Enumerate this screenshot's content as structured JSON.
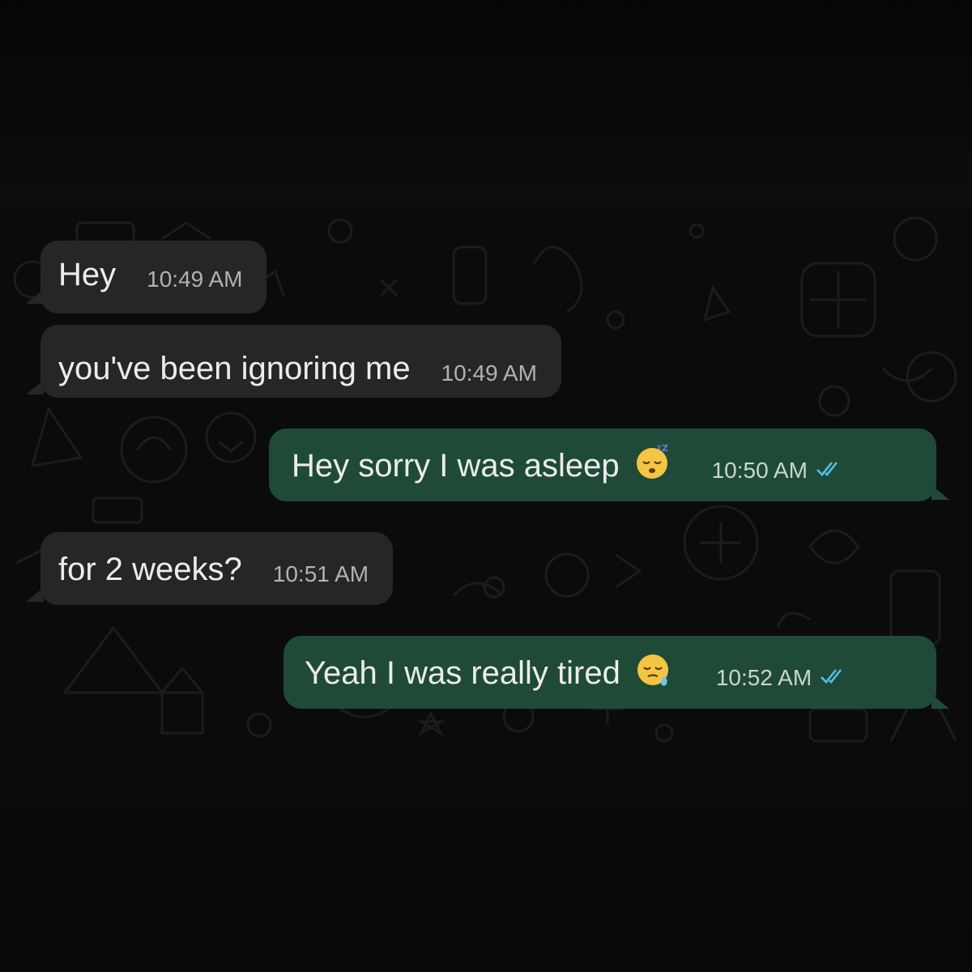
{
  "messages": [
    {
      "direction": "incoming",
      "text": "Hey",
      "time": "10:49 AM"
    },
    {
      "direction": "incoming",
      "text": "you've been ignoring me",
      "time": "10:49 AM"
    },
    {
      "direction": "outgoing",
      "text": "Hey sorry I was asleep",
      "emoji": "sleeping-face-icon",
      "time": "10:50 AM",
      "status": "read"
    },
    {
      "direction": "incoming",
      "text": "for 2 weeks?",
      "time": "10:51 AM"
    },
    {
      "direction": "outgoing",
      "text": "Yeah I was really tired",
      "emoji": "sleepy-face-icon",
      "time": "10:52 AM",
      "status": "read"
    }
  ],
  "colors": {
    "incoming_bubble": "#262626",
    "outgoing_bubble": "#1f4a37",
    "read_ticks": "#53bdeb",
    "background": "#0b0b0b"
  }
}
